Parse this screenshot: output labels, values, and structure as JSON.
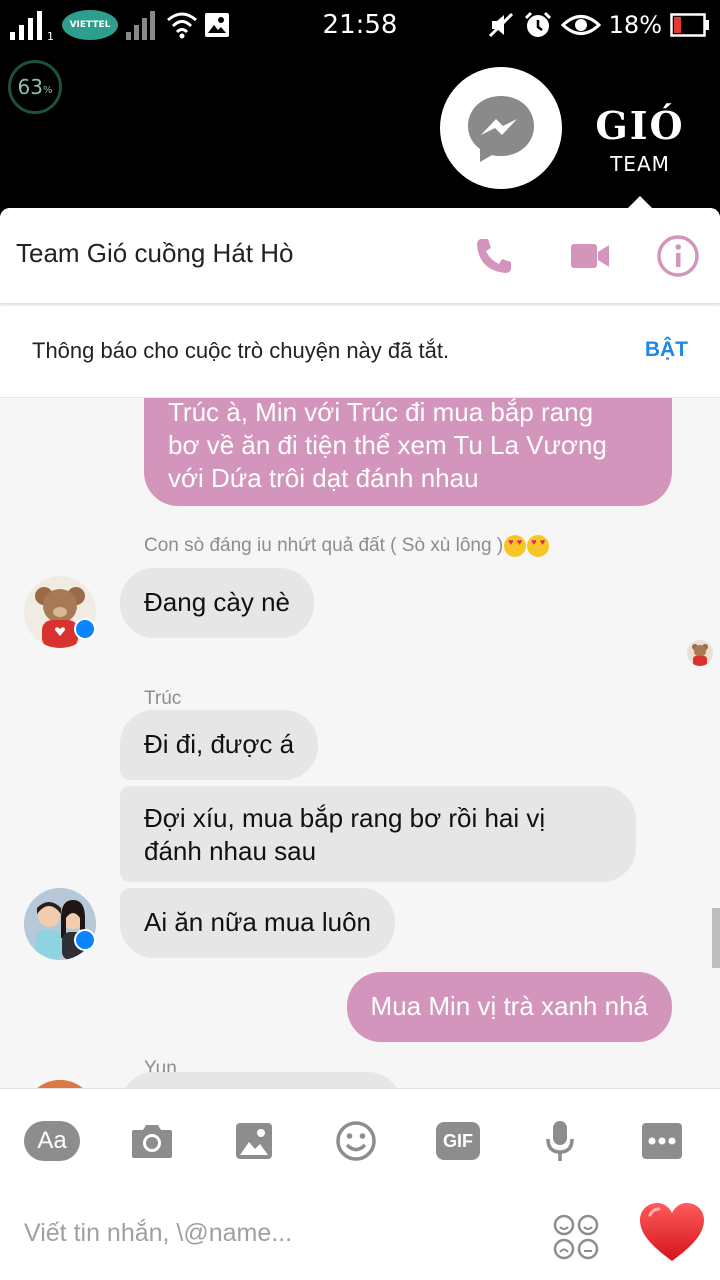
{
  "status_bar": {
    "carrier": "VIETTEL",
    "time": "21:58",
    "battery_percent": "18%",
    "sim_slot": "1"
  },
  "overlay": {
    "ram_usage": "63",
    "ram_unit": "%",
    "group_logo_text": "GIÓ",
    "group_logo_sub": "TEAM"
  },
  "header": {
    "title": "Team Gió cuồng Hát Hò"
  },
  "notice": {
    "text": "Thông báo cho cuộc trò chuyện này đã tắt.",
    "action": "BẬT"
  },
  "messages": [
    {
      "direction": "out",
      "lines": [
        "Trúc à, Min với Trúc đi mua bắp rang",
        "bơ về ăn đi tiện thể xem Tu La Vương",
        "với Dứa trôi dạt đánh nhau"
      ]
    },
    {
      "sender": "Con sò đáng iu nhứt quả đất ( Sò xù lông )"
    },
    {
      "direction": "in",
      "text": "Đang cày nè"
    },
    {
      "sender": "Trúc"
    },
    {
      "direction": "in",
      "text": "Đi đi, được á"
    },
    {
      "direction": "in",
      "lines": [
        "Đợi xíu, mua bắp rang bơ rồi hai vị",
        "đánh nhau sau"
      ]
    },
    {
      "direction": "in",
      "text": "Ai ăn nữa mua luôn"
    },
    {
      "direction": "out",
      "text": "Mua Min vị trà xanh nhá"
    },
    {
      "sender": "Yun"
    }
  ],
  "composer": {
    "placeholder": "Viết tin nhắn, \\@name...",
    "aa_label": "Aa",
    "gif_label": "GIF"
  },
  "colors": {
    "accent_pink": "#d395bb",
    "incoming_bubble": "#e6e6e6",
    "action_blue": "#2089e5",
    "messenger_blue": "#0a84ff"
  }
}
